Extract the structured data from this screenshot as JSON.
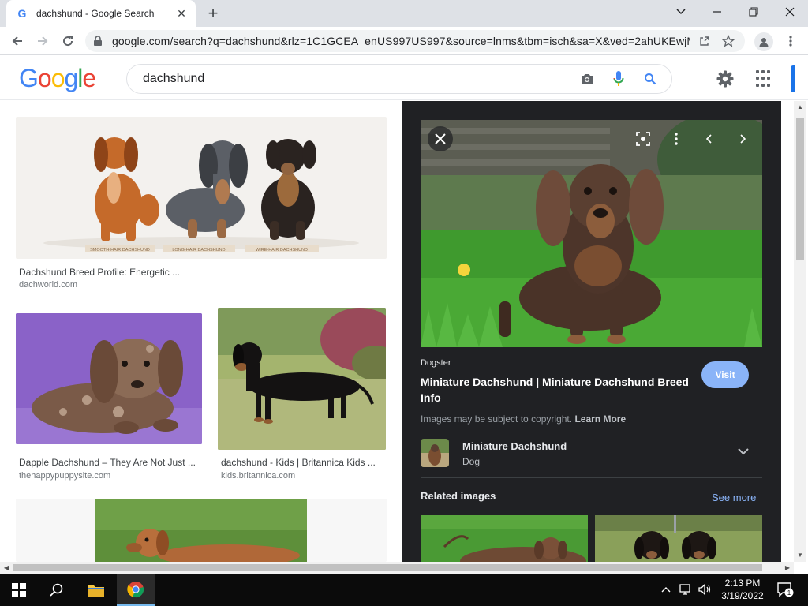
{
  "browser": {
    "tab_title": "dachshund - Google Search",
    "tab_favicon": "G",
    "url": "google.com/search?q=dachshund&rlz=1C1GCEA_enUS997US997&source=lnms&tbm=isch&sa=X&ved=2ahUKEwjM..."
  },
  "google": {
    "logo_letters": [
      "G",
      "o",
      "o",
      "g",
      "l",
      "e"
    ],
    "logo_colors": [
      "#4285f4",
      "#ea4335",
      "#fbbc05",
      "#4285f4",
      "#34a853",
      "#ea4335"
    ],
    "search_value": "dachshund"
  },
  "results": [
    {
      "title": "Dachshund Breed Profile: Energetic ...",
      "source": "dachworld.com",
      "captions": [
        "SMOOTH-HAIR DACHSHUND",
        "LONG-HAIR DACHSHUND",
        "WIRE-HAIR DACHSHUND"
      ]
    },
    {
      "title": "Dapple Dachshund – They Are Not Just ...",
      "source": "thehappypuppysite.com"
    },
    {
      "title": "dachshund - Kids | Britannica Kids ...",
      "source": "kids.britannica.com"
    }
  ],
  "preview": {
    "source_name": "Dogster",
    "title": "Miniature Dachshund | Miniature Dachshund Breed Info",
    "visit_label": "Visit",
    "copyright_text": "Images may be subject to copyright.",
    "learn_more": "Learn More",
    "entity_name": "Miniature Dachshund",
    "entity_type": "Dog",
    "related_title": "Related images",
    "see_more": "See more"
  },
  "taskbar": {
    "time": "2:13 PM",
    "date": "3/19/2022",
    "notification_count": "1"
  },
  "colors": {
    "accent": "#1a73e8",
    "panel_bg": "#202124",
    "visit_button": "#8ab4f8"
  }
}
